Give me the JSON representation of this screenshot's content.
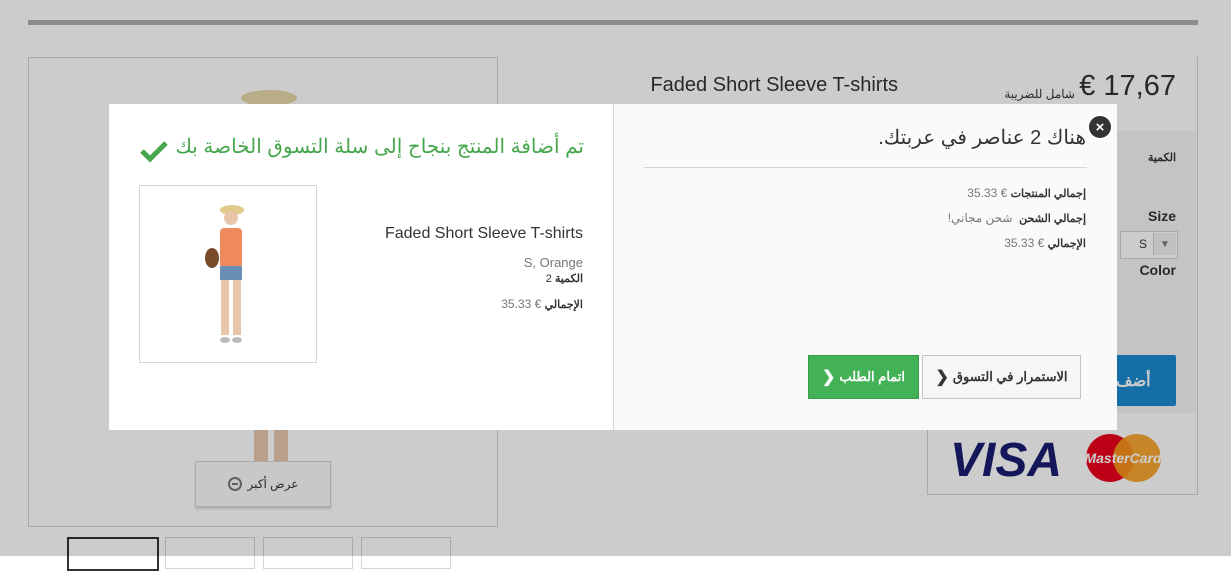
{
  "product": {
    "name": "Faded Short Sleeve T-shirts",
    "price": "€ 17,67",
    "tax_note": "شامل للضريبة",
    "quantity_label": "الكمية",
    "size_label": "Size",
    "size_value": "S",
    "color_label": "Color",
    "add_to_cart": "أضف",
    "zoom_label": "عرض أكبر"
  },
  "modal": {
    "success_message": "تم أضافة المنتج بنجاح إلى سلة التسوق الخاصة بك",
    "item": {
      "name": "Faded Short Sleeve T-shirts",
      "attributes": "S, Orange",
      "quantity_label": "الكمية",
      "quantity_value": "2",
      "total_label": "الإجمالي",
      "total_value": "€ 35.33"
    },
    "cart_count_text": "هناك 2 عناصر في عربتك.",
    "summary": {
      "products_total_label": "إجمالي المنتجات",
      "products_total_value": "€ 35.33",
      "shipping_label": "إجمالي الشحن",
      "shipping_value": "شحن مجاني!",
      "total_label": "الإجمالي",
      "total_value": "€ 35.33"
    },
    "continue_button": "الاستمرار في التسوق",
    "checkout_button": "اتمام الطلب"
  },
  "payment": {
    "visa": "VISA",
    "mastercard": "MasterCard"
  },
  "colors": {
    "success": "#46a74e",
    "checkout": "#43b155",
    "primary": "#1b8bd0"
  },
  "icons": [
    "close-icon",
    "check-icon",
    "chevron-left-icon",
    "zoom-icon",
    "dropdown-arrow-icon"
  ]
}
